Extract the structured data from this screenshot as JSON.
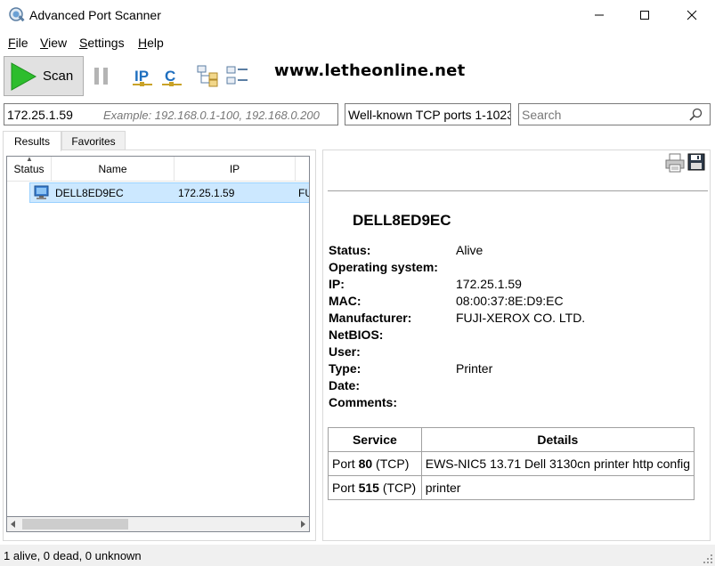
{
  "window": {
    "title": "Advanced Port Scanner"
  },
  "menu": {
    "items": [
      {
        "key": "F",
        "rest": "ile"
      },
      {
        "key": "V",
        "rest": "iew"
      },
      {
        "key": "S",
        "rest": "ettings"
      },
      {
        "key": "H",
        "rest": "elp"
      }
    ]
  },
  "toolbar": {
    "scan_label": "Scan",
    "ip_icon_text": "IP",
    "c_icon_text": "C",
    "site_text": "www.letheonline.net"
  },
  "inputs": {
    "ip_range_value": "172.25.1.59",
    "ip_range_hint": "Example: 192.168.0.1-100, 192.168.0.200",
    "ports_value": "Well-known TCP ports 1-1023",
    "search_placeholder": "Search"
  },
  "tabs": {
    "results": "Results",
    "favorites": "Favorites"
  },
  "results": {
    "columns": [
      "Status",
      "Name",
      "IP",
      ""
    ],
    "rows": [
      {
        "name": "DELL8ED9EC",
        "ip": "172.25.1.59",
        "manufacturer_partial": "FU"
      }
    ]
  },
  "details": {
    "host_name": "DELL8ED9EC",
    "fields": [
      {
        "label": "Status:",
        "value": "Alive"
      },
      {
        "label": "Operating system:",
        "value": ""
      },
      {
        "label": "IP:",
        "value": "172.25.1.59"
      },
      {
        "label": "MAC:",
        "value": "08:00:37:8E:D9:EC"
      },
      {
        "label": "Manufacturer:",
        "value": "FUJI-XEROX CO. LTD."
      },
      {
        "label": "NetBIOS:",
        "value": ""
      },
      {
        "label": "User:",
        "value": ""
      },
      {
        "label": "Type:",
        "value": "Printer"
      },
      {
        "label": "Date:",
        "value": ""
      },
      {
        "label": "Comments:",
        "value": ""
      }
    ],
    "services_headers": [
      "Service",
      "Details"
    ],
    "services": [
      {
        "prefix": "Port ",
        "port": "80",
        "proto": " (TCP)",
        "details": "EWS-NIC5 13.71 Dell 3130cn printer http config"
      },
      {
        "prefix": "Port ",
        "port": "515",
        "proto": " (TCP)",
        "details": "printer"
      }
    ]
  },
  "statusbar": {
    "text": "1 alive, 0 dead, 0 unknown"
  },
  "colors": {
    "selection": "#cce8ff",
    "scan_green": "#2dbd2d",
    "icon_blue": "#1f6fbf"
  }
}
